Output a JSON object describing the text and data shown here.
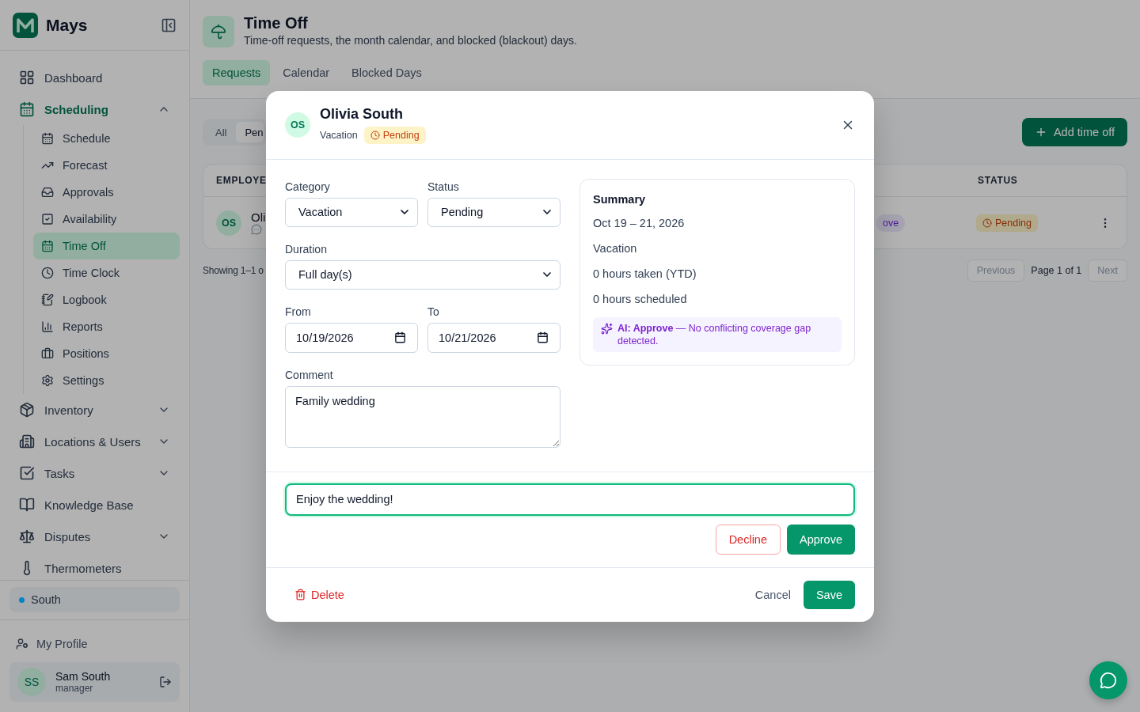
{
  "sidebar": {
    "brand": "Mays",
    "nav": [
      {
        "label": "Dashboard",
        "kind": "link",
        "selected": false
      },
      {
        "label": "Scheduling",
        "kind": "group",
        "expanded": true,
        "selected": true,
        "children": [
          {
            "label": "Schedule",
            "selected": false
          },
          {
            "label": "Forecast",
            "selected": false
          },
          {
            "label": "Approvals",
            "selected": false
          },
          {
            "label": "Availability",
            "selected": false
          },
          {
            "label": "Time Off",
            "selected": true
          },
          {
            "label": "Time Clock",
            "selected": false
          },
          {
            "label": "Logbook",
            "selected": false
          },
          {
            "label": "Reports",
            "selected": false
          },
          {
            "label": "Positions",
            "selected": false
          },
          {
            "label": "Settings",
            "selected": false
          }
        ]
      },
      {
        "label": "Inventory",
        "kind": "group",
        "expanded": false,
        "selected": false
      },
      {
        "label": "Locations & Users",
        "kind": "group",
        "expanded": false,
        "selected": false
      },
      {
        "label": "Tasks",
        "kind": "group",
        "expanded": false,
        "selected": false
      },
      {
        "label": "Knowledge Base",
        "kind": "link",
        "selected": false
      },
      {
        "label": "Disputes",
        "kind": "group",
        "expanded": false,
        "selected": false
      },
      {
        "label": "Thermometers",
        "kind": "link",
        "selected": false
      }
    ],
    "location": {
      "name": "South",
      "color": "#0284c7"
    },
    "profile_link": "My Profile",
    "user": {
      "initials": "SS",
      "name": "Sam South",
      "role": "manager"
    }
  },
  "page": {
    "title": "Time Off",
    "subtitle": "Time-off requests, the month calendar, and blocked (blackout) days.",
    "tabs": [
      {
        "label": "Requests",
        "selected": true
      },
      {
        "label": "Calendar",
        "selected": false
      },
      {
        "label": "Blocked Days",
        "selected": false
      }
    ],
    "filters": [
      {
        "label": "All",
        "selected": false
      },
      {
        "label": "Pen",
        "selected": true
      }
    ],
    "add_button": "Add time off",
    "table": {
      "columns": [
        {
          "label": "EMPLOYE"
        },
        {
          "label": "STATUS"
        }
      ],
      "rows": [
        {
          "initials": "OS",
          "name": "Oli",
          "column_3": "ove",
          "status": "Pending"
        }
      ]
    },
    "pagination": {
      "showing": "Showing 1–1 o",
      "previous": "Previous",
      "page": "Page 1 of 1",
      "next": "Next"
    }
  },
  "modal": {
    "initials": "OS",
    "name": "Olivia South",
    "category": "Vacation",
    "status": "Pending",
    "fields": [
      {
        "kind": "select",
        "label": "Category",
        "value": "Vacation",
        "span": false
      },
      {
        "kind": "select",
        "label": "Status",
        "value": "Pending",
        "span": false
      },
      {
        "kind": "select",
        "label": "Duration",
        "value": "Full day(s)",
        "span": true
      },
      {
        "kind": "date",
        "label": "From",
        "value": "10/19/2026",
        "span": false
      },
      {
        "kind": "date",
        "label": "To",
        "value": "10/21/2026",
        "span": false
      },
      {
        "kind": "textarea",
        "label": "Comment",
        "value": "Family wedding",
        "span": true
      }
    ],
    "summary": {
      "title": "Summary",
      "lines": [
        "Oct 19 – 21, 2026",
        "Vacation",
        "0 hours taken (YTD)",
        "0 hours scheduled"
      ],
      "ai_note": "**AI: Approve** — No conflicting coverage gap detected."
    },
    "note": {
      "value": "Enjoy the wedding!",
      "focused": true
    },
    "decline": "Decline",
    "approve": "Approve",
    "delete": "Delete",
    "cancel": "Cancel",
    "save": "Save"
  }
}
